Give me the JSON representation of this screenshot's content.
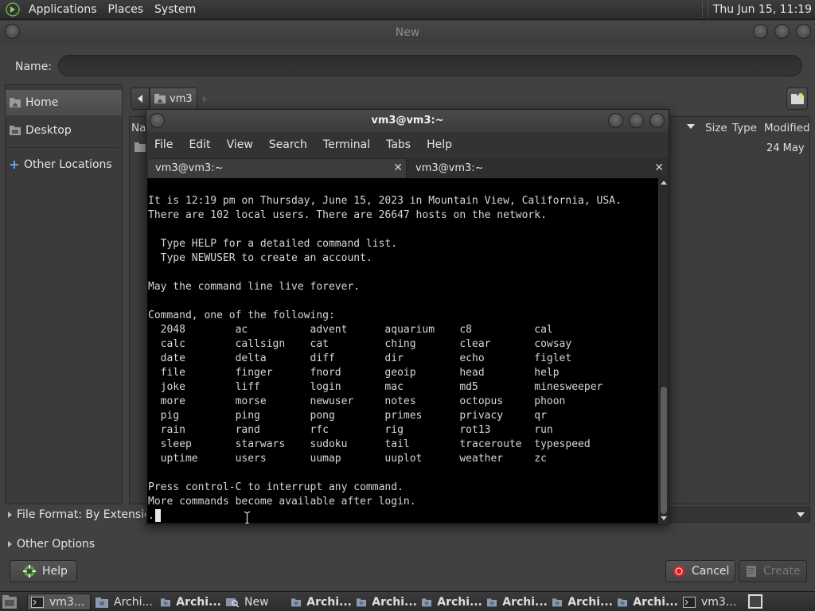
{
  "top_panel": {
    "menus": [
      "Applications",
      "Places",
      "System"
    ],
    "clock": "Thu Jun 15, 11:19"
  },
  "dialog": {
    "title": "New",
    "name_label": "Name:",
    "name_value": "",
    "sidebar": [
      {
        "label": "Home",
        "icon": "home-folder-icon",
        "active": true
      },
      {
        "label": "Desktop",
        "icon": "desktop-folder-icon",
        "active": false
      },
      {
        "label": "Other Locations",
        "icon": "plus-icon",
        "active": false
      }
    ],
    "path": {
      "crumb": "vm3"
    },
    "columns": {
      "name": "Na",
      "size": "Size",
      "type": "Type",
      "modified": "Modified"
    },
    "rows": [
      {
        "modified": "24 May"
      }
    ],
    "file_format": "File Format: By Extension",
    "other_options": "Other Options",
    "buttons": {
      "help": "Help",
      "cancel": "Cancel",
      "create": "Create"
    }
  },
  "terminal": {
    "title": "vm3@vm3:~",
    "menu": [
      "File",
      "Edit",
      "View",
      "Search",
      "Terminal",
      "Tabs",
      "Help"
    ],
    "tabs": [
      {
        "label": "vm3@vm3:~",
        "active": true
      },
      {
        "label": "vm3@vm3:~",
        "active": false
      }
    ],
    "output": "It is 12:19 pm on Thursday, June 15, 2023 in Mountain View, California, USA.\nThere are 102 local users. There are 26647 hosts on the network.\n\n  Type HELP for a detailed command list.\n  Type NEWUSER to create an account.\n\nMay the command line live forever.\n\nCommand, one of the following:\n  2048        ac          advent      aquarium    c8          cal\n  calc        callsign    cat         ching       clear       cowsay\n  date        delta       diff        dir         echo        figlet\n  file        finger      fnord       geoip       head        help\n  joke        liff        login       mac         md5         minesweeper\n  more        morse       newuser     notes       octopus     phoon\n  pig         ping        pong        primes      privacy     qr\n  rain        rand        rfc         rig         rot13       run\n  sleep       starwars    sudoku      tail        traceroute  typespeed\n  uptime      users       uumap       uuplot      weather     zc\n\nPress control-C to interrupt any command.\nMore commands become available after login.\n."
  },
  "taskbar": {
    "items": [
      {
        "label": "vm3...",
        "icon": "terminal-icon",
        "active": true,
        "bold": false
      },
      {
        "label": "Archi...",
        "icon": "archive-folder-icon",
        "active": false,
        "bold": false
      },
      {
        "label": "Archi...",
        "icon": "archive-folder-icon",
        "active": false,
        "bold": true
      },
      {
        "label": "New",
        "icon": "search-file-icon",
        "active": false,
        "bold": false
      },
      {
        "label": "Archi...",
        "icon": "archive-folder-icon",
        "active": false,
        "bold": true
      },
      {
        "label": "Archi...",
        "icon": "archive-folder-icon",
        "active": false,
        "bold": true
      },
      {
        "label": "Archi...",
        "icon": "archive-folder-icon",
        "active": false,
        "bold": true
      },
      {
        "label": "Archi...",
        "icon": "archive-folder-icon",
        "active": false,
        "bold": true
      },
      {
        "label": "Archi...",
        "icon": "archive-folder-icon",
        "active": false,
        "bold": true
      },
      {
        "label": "Archi...",
        "icon": "archive-folder-icon",
        "active": false,
        "bold": true
      },
      {
        "label": "vm3...",
        "icon": "terminal-icon",
        "active": false,
        "bold": false
      }
    ]
  }
}
